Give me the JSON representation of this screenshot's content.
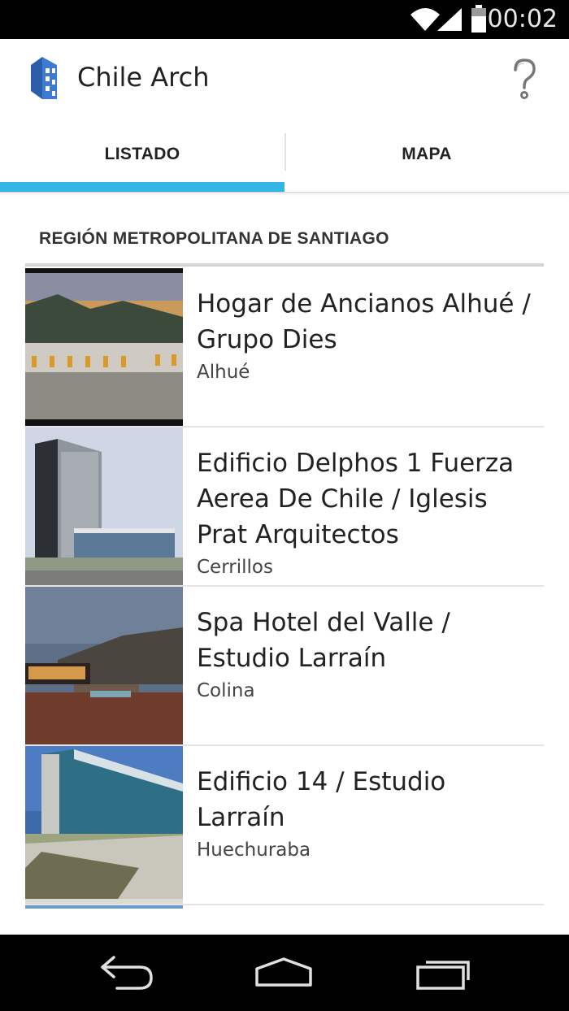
{
  "status_bar": {
    "time": "00:02",
    "icons": [
      "wifi-icon",
      "signal-icon",
      "battery-icon"
    ]
  },
  "app_bar": {
    "title": "Chile Arch",
    "logo_icon": "building-logo-icon",
    "help_icon": "help-icon"
  },
  "tabs": [
    {
      "label": "LISTADO",
      "selected": true
    },
    {
      "label": "MAPA",
      "selected": false
    }
  ],
  "accent_color": "#33b5e5",
  "section": {
    "title": "REGIÓN METROPOLITANA DE SANTIAGO"
  },
  "items": [
    {
      "title": "Hogar de Ancianos Alhué / Grupo Dies",
      "location": "Alhué"
    },
    {
      "title": "Edificio Delphos 1 Fuerza Aerea De Chile / Iglesis Prat Arquitectos",
      "location": "Cerrillos"
    },
    {
      "title": "Spa Hotel del Valle / Estudio Larraín",
      "location": "Colina"
    },
    {
      "title": "Edificio 14 / Estudio Larraín",
      "location": "Huechuraba"
    }
  ],
  "nav_bar": {
    "icons": [
      "back-icon",
      "home-icon",
      "recent-apps-icon"
    ]
  }
}
